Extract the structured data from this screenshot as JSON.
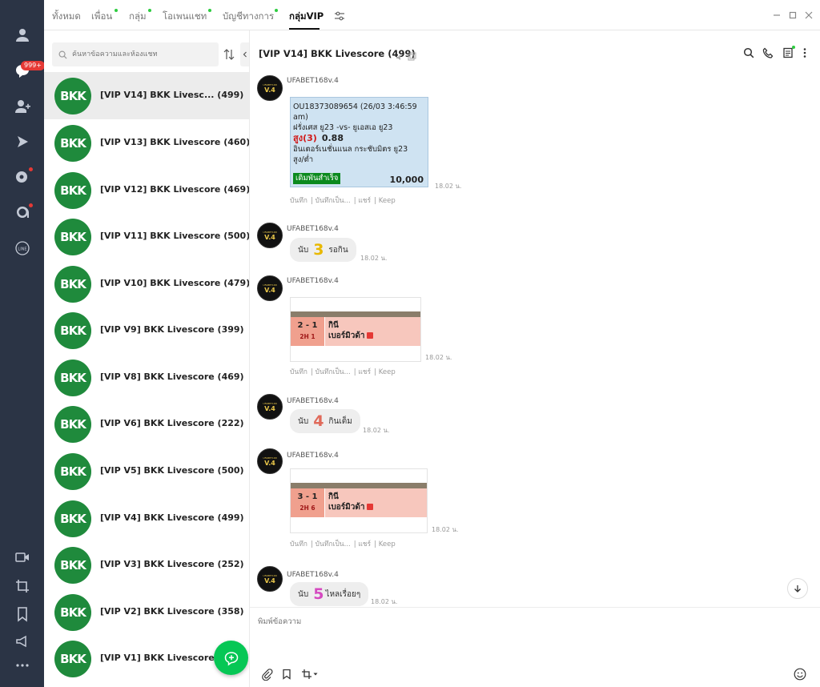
{
  "rail": {
    "unread_badge": "999+",
    "icons": [
      "person-icon",
      "chat-icon",
      "add-friend-icon",
      "play-icon",
      "timeline-icon",
      "openchat-icon",
      "line-icon",
      "video-call-icon",
      "crop-icon",
      "bookmark-icon",
      "announce-icon",
      "more-icon"
    ]
  },
  "tabs": [
    {
      "label": "ทั้งหมด",
      "dot": false
    },
    {
      "label": "เพื่อน",
      "dot": true
    },
    {
      "label": "กลุ่ม",
      "dot": true
    },
    {
      "label": "โอเพนแชท",
      "dot": true
    },
    {
      "label": "บัญชีทางการ",
      "dot": true
    },
    {
      "label": "กลุ่มVIP",
      "dot": false,
      "active": true
    }
  ],
  "search": {
    "placeholder": "ค้นหาข้อความและห้องแชท"
  },
  "chats": [
    {
      "name": "[VIP V14] BKK Livesc... (499)",
      "selected": true
    },
    {
      "name": "[VIP V13] BKK Livescore (460)"
    },
    {
      "name": "[VIP V12] BKK Livescore (469)"
    },
    {
      "name": "[VIP V11] BKK Livescore (500)"
    },
    {
      "name": "[VIP V10] BKK Livescore (479)"
    },
    {
      "name": "[VIP V9] BKK Livescore (399)"
    },
    {
      "name": "[VIP V8] BKK Livescore (469)"
    },
    {
      "name": "[VIP V6] BKK Livescore (222)"
    },
    {
      "name": "[VIP V5] BKK Livescore (500)"
    },
    {
      "name": "[VIP V4] BKK Livescore (499)"
    },
    {
      "name": "[VIP V3] BKK Livescore (252)"
    },
    {
      "name": "[VIP V2] BKK Livescore (358)"
    },
    {
      "name": "[VIP V1] BKK Livescore (123"
    }
  ],
  "avatar_logo": "BKK",
  "conversation": {
    "title": "[VIP V14] BKK Livescore",
    "count": "(499)",
    "sender": "UFABET168v.4",
    "avatar_text_top": "UFABET168",
    "avatar_text_bottom": "V.4",
    "actions": [
      "บันทึก",
      "บันทึกเป็น...",
      "แชร์",
      "Keep"
    ],
    "bet": {
      "line1": "OU18373089654 (26/03 3:46:59",
      "line2": "am)",
      "line3": "ฝรั่งเศส ยู23 -vs- ยูเอสเอ ยู23",
      "pick": "สูง(3)",
      "odds": "0.88",
      "league": "อินเตอร์เนชั่นแนล กระชับมิตร ยู23",
      "market": "สูง/ต่ำ",
      "status": "เดิมพันสำเร็จ",
      "amount": "10,000",
      "time": "18.02 น."
    },
    "msg2": {
      "prefix": "นับ",
      "num": "3",
      "text": "รอกิน",
      "time": "18.02 น."
    },
    "score1": {
      "score": "2 - 1",
      "half": "2H 1",
      "team1": "กินี",
      "team2": "เบอร์มิวด้า",
      "time": "18.02 น."
    },
    "msg4": {
      "prefix": "นับ",
      "num": "4",
      "text": "กินเต็ม",
      "time": "18.02 น."
    },
    "score2": {
      "score": "3 - 1",
      "half": "2H 6",
      "team1": "กินี",
      "team2": "เบอร์มิวด้า",
      "time": "18.02 น."
    },
    "msg6": {
      "prefix": "นับ",
      "num": "5",
      "text": "ไหลเรื่อยๆ",
      "time": "18.02 น."
    },
    "composer_placeholder": "พิมพ์ข้อความ"
  },
  "colors": {
    "rail": "#2b3445",
    "brand_green": "#06c755",
    "bkk_green": "#1f8a3c",
    "badge_red": "#e53935",
    "bet_ok": "#0b8a1e"
  }
}
